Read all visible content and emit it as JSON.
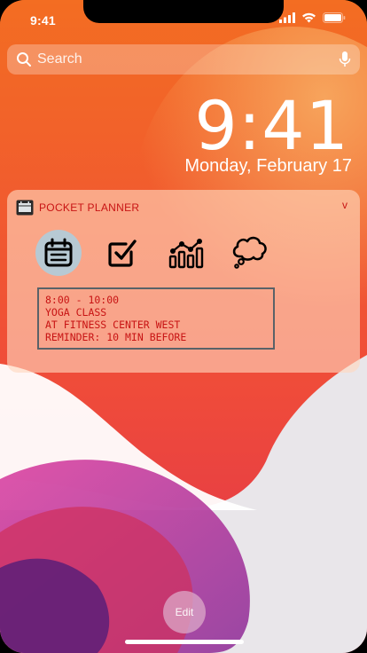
{
  "status_bar": {
    "time": "9:41",
    "icons": [
      "cellular-signal-icon",
      "wifi-icon",
      "battery-icon"
    ]
  },
  "search": {
    "placeholder": "Search",
    "icons": [
      "search-icon",
      "microphone-icon"
    ]
  },
  "lock_screen": {
    "time": "9:41",
    "date": "Monday, February 17"
  },
  "notification": {
    "app_name": "POCKET PLANNER",
    "expand_glyph": "v",
    "tools": [
      {
        "name": "calendar",
        "icon": "calendar-icon",
        "selected": true
      },
      {
        "name": "tasks",
        "icon": "checkbox-icon",
        "selected": false
      },
      {
        "name": "stats",
        "icon": "chart-icon",
        "selected": false
      },
      {
        "name": "notes",
        "icon": "thought-bubble-icon",
        "selected": false
      }
    ],
    "event": {
      "time_range": "8:00 - 10:00",
      "title": "Yoga Class",
      "location": "at Fitness Center West",
      "reminder": "Reminder: 10 min before"
    }
  },
  "bottom": {
    "edit_label": "Edit"
  },
  "colors": {
    "accent_red": "#c81414",
    "card_bg": "#ffd7be",
    "selected_icon_bg": "#b7c9d3"
  }
}
